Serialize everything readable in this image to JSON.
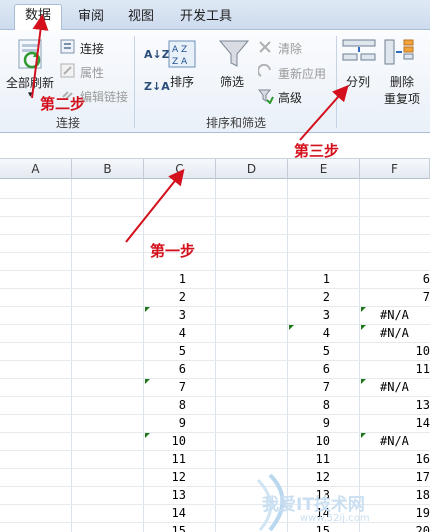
{
  "tabs": [
    "数据",
    "审阅",
    "视图",
    "开发工具"
  ],
  "ribbon": {
    "refresh_all": "全部刷新",
    "connections": "连接",
    "properties": "属性",
    "edit_links": "编辑链接",
    "group_connections": "连接",
    "sort": "排序",
    "filter": "筛选",
    "clear": "清除",
    "reapply": "重新应用",
    "advanced": "高级",
    "group_sort_filter": "排序和筛选",
    "text_to_columns": "分列",
    "remove_duplicates": "删除",
    "duplicates_suffix": "重复项"
  },
  "columns": [
    "A",
    "B",
    "C",
    "D",
    "E",
    "F"
  ],
  "rows": [
    {
      "c": "1",
      "e": "1",
      "f": "6"
    },
    {
      "c": "2",
      "e": "2",
      "f": "7"
    },
    {
      "c": "3",
      "e": "3",
      "f": "#N/A"
    },
    {
      "c": "4",
      "e": "4",
      "f": "#N/A"
    },
    {
      "c": "5",
      "e": "5",
      "f": "10"
    },
    {
      "c": "6",
      "e": "6",
      "f": "11"
    },
    {
      "c": "7",
      "e": "7",
      "f": "#N/A"
    },
    {
      "c": "8",
      "e": "8",
      "f": "13"
    },
    {
      "c": "9",
      "e": "9",
      "f": "14"
    },
    {
      "c": "10",
      "e": "10",
      "f": "#N/A"
    },
    {
      "c": "11",
      "e": "11",
      "f": "16"
    },
    {
      "c": "12",
      "e": "12",
      "f": "17"
    },
    {
      "c": "13",
      "e": "13",
      "f": "18"
    },
    {
      "c": "14",
      "e": "14",
      "f": "19"
    },
    {
      "c": "15",
      "e": "15",
      "f": "20"
    }
  ],
  "annotations": {
    "step1": "第一步",
    "step2": "第二步",
    "step3": "第三步"
  },
  "watermark": {
    "text": "我爱IT技术网",
    "url": "www.52ij.com"
  },
  "colors": {
    "annotation": "#d3101c",
    "error_triangle": "#1a7a1a"
  }
}
